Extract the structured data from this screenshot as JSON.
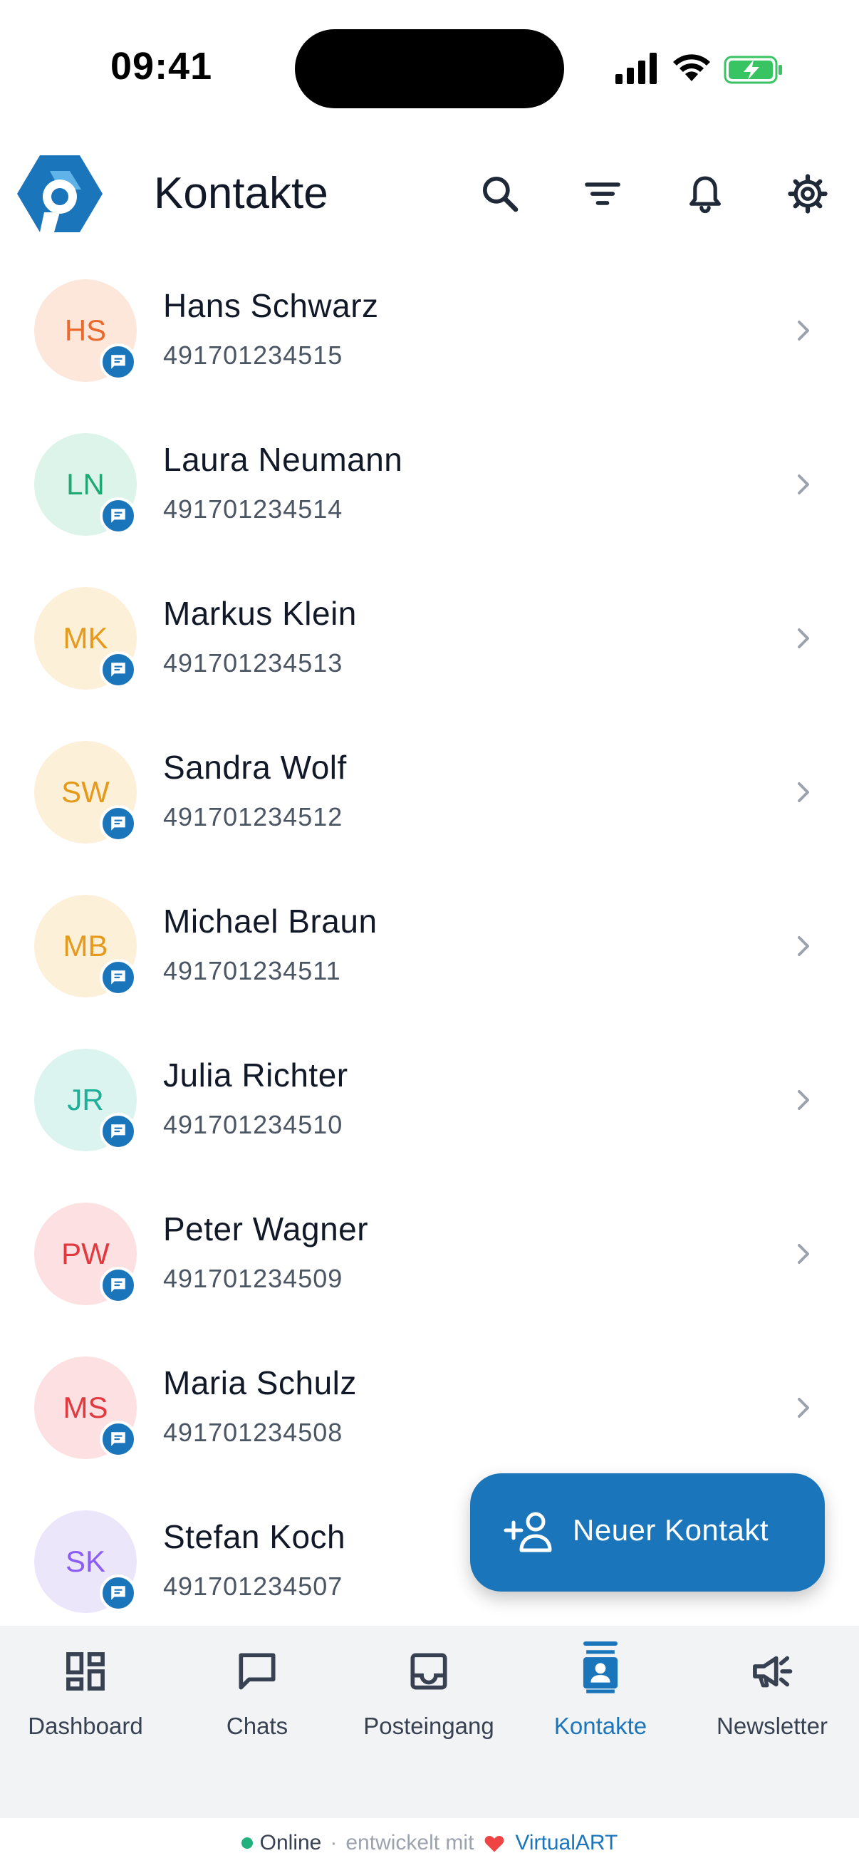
{
  "status_bar": {
    "time": "09:41"
  },
  "header": {
    "title": "Kontakte",
    "icons": [
      "search-icon",
      "filter-icon",
      "bell-icon",
      "gear-icon"
    ]
  },
  "contacts": [
    {
      "initials": "HS",
      "name": "Hans Schwarz",
      "phone": "491701234515",
      "bg": "#fde6da",
      "fg": "#ea6a2e"
    },
    {
      "initials": "LN",
      "name": "Laura Neumann",
      "phone": "491701234514",
      "bg": "#dcf4ea",
      "fg": "#1fa874"
    },
    {
      "initials": "MK",
      "name": "Markus Klein",
      "phone": "491701234513",
      "bg": "#fdf0d9",
      "fg": "#e69a1c"
    },
    {
      "initials": "SW",
      "name": "Sandra Wolf",
      "phone": "491701234512",
      "bg": "#fdf0d9",
      "fg": "#e69a1c"
    },
    {
      "initials": "MB",
      "name": "Michael Braun",
      "phone": "491701234511",
      "bg": "#fdf0d9",
      "fg": "#e69a1c"
    },
    {
      "initials": "JR",
      "name": "Julia Richter",
      "phone": "491701234510",
      "bg": "#dcf4ef",
      "fg": "#1fae98"
    },
    {
      "initials": "PW",
      "name": "Peter Wagner",
      "phone": "491701234509",
      "bg": "#fde0e2",
      "fg": "#e2393f"
    },
    {
      "initials": "MS",
      "name": "Maria Schulz",
      "phone": "491701234508",
      "bg": "#fde0e2",
      "fg": "#e2393f"
    },
    {
      "initials": "SK",
      "name": "Stefan Koch",
      "phone": "491701234507",
      "bg": "#ece6fb",
      "fg": "#8b5cf6"
    }
  ],
  "fab": {
    "label": "Neuer Kontakt"
  },
  "nav": {
    "items": [
      {
        "label": "Dashboard",
        "icon": "dashboard-icon"
      },
      {
        "label": "Chats",
        "icon": "chat-icon"
      },
      {
        "label": "Posteingang",
        "icon": "inbox-icon"
      },
      {
        "label": "Kontakte",
        "icon": "contacts-icon",
        "active": true
      },
      {
        "label": "Newsletter",
        "icon": "megaphone-icon"
      }
    ]
  },
  "footer": {
    "status": "Online",
    "separator": "·",
    "developed_with": "entwickelt mit",
    "brand": "VirtualART"
  },
  "colors": {
    "accent": "#1b75bb",
    "online": "#22b07d",
    "heart": "#ef4444"
  }
}
